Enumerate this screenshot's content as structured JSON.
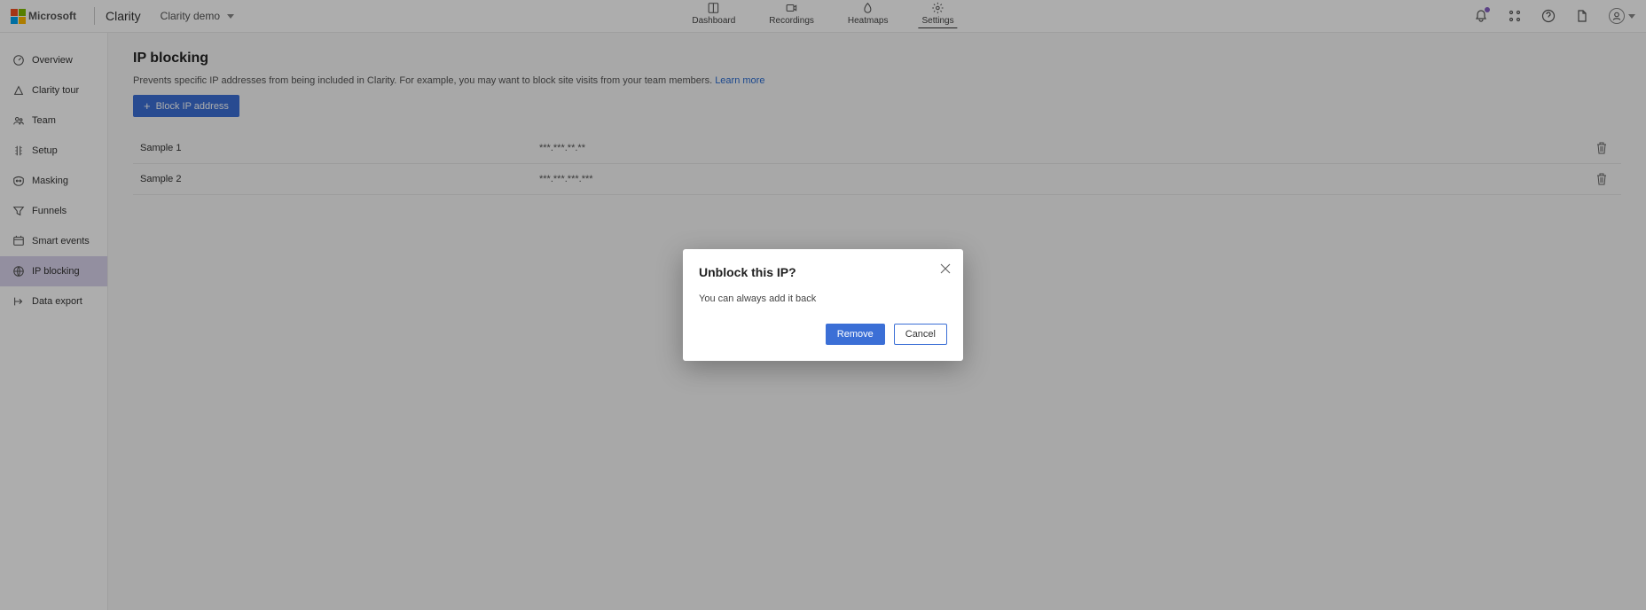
{
  "header": {
    "microsoft": "Microsoft",
    "brand": "Clarity",
    "project": "Clarity demo",
    "nav": {
      "dashboard": "Dashboard",
      "recordings": "Recordings",
      "heatmaps": "Heatmaps",
      "settings": "Settings"
    }
  },
  "sidebar": {
    "items": [
      {
        "label": "Overview"
      },
      {
        "label": "Clarity tour"
      },
      {
        "label": "Team"
      },
      {
        "label": "Setup"
      },
      {
        "label": "Masking"
      },
      {
        "label": "Funnels"
      },
      {
        "label": "Smart events"
      },
      {
        "label": "IP blocking"
      },
      {
        "label": "Data export"
      }
    ]
  },
  "main": {
    "title": "IP blocking",
    "description": "Prevents specific IP addresses from being included in Clarity. For example, you may want to block site visits from your team members. ",
    "learn_more": "Learn more",
    "block_button": "Block IP address",
    "rows": [
      {
        "name": "Sample 1",
        "ip": "***.***.**.**"
      },
      {
        "name": "Sample 2",
        "ip": "***.***.***.***"
      }
    ]
  },
  "dialog": {
    "title": "Unblock this IP?",
    "body": "You can always add it back",
    "remove": "Remove",
    "cancel": "Cancel"
  }
}
